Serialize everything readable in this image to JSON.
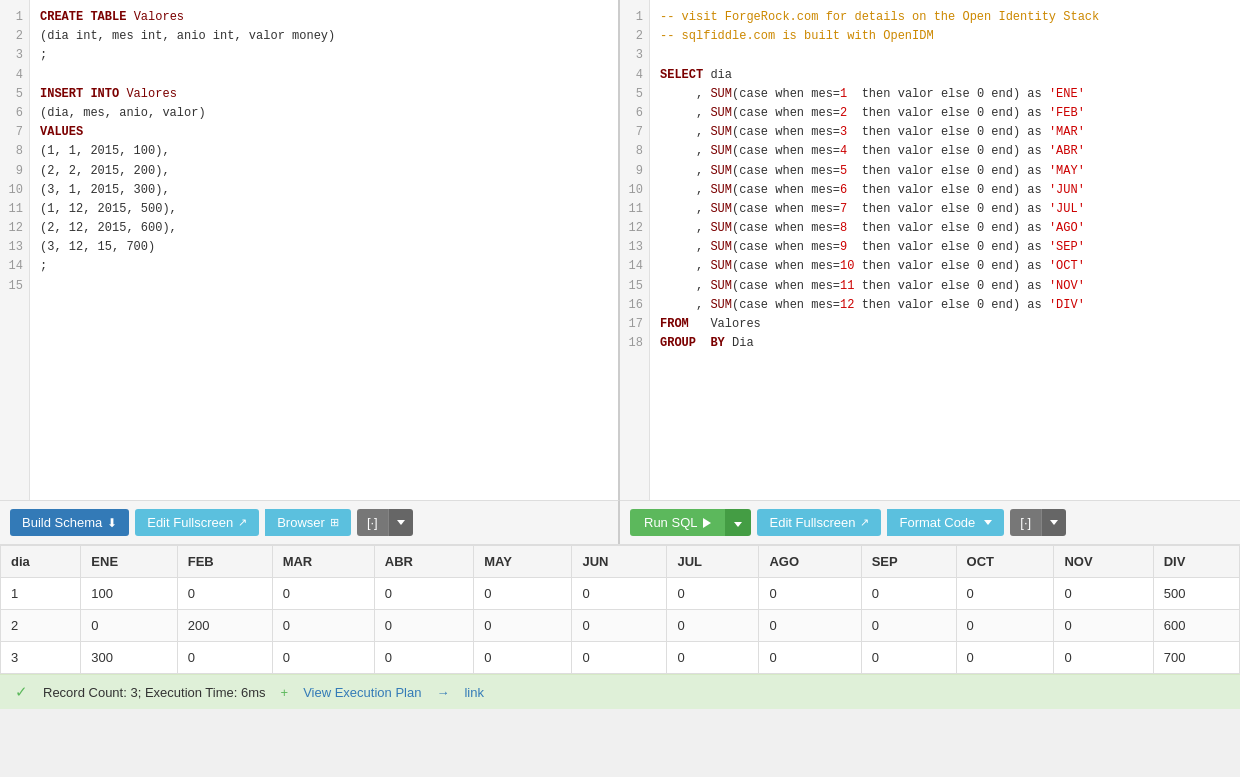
{
  "left_editor": {
    "lines": [
      1,
      2,
      3,
      4,
      5,
      6,
      7,
      8,
      9,
      10,
      11,
      12,
      13,
      14,
      15
    ],
    "code_html": "left"
  },
  "right_editor": {
    "lines": [
      1,
      2,
      3,
      4,
      5,
      6,
      7,
      8,
      9,
      10,
      11,
      12,
      13,
      14,
      15,
      16,
      17,
      18
    ],
    "code_html": "right"
  },
  "left_toolbar": {
    "build_schema": "Build Schema",
    "edit_fullscreen": "Edit Fullscreen",
    "browser": "Browser",
    "bracket": "[·]"
  },
  "right_toolbar": {
    "run_sql": "Run SQL",
    "edit_fullscreen": "Edit Fullscreen",
    "format_code": "Format Code",
    "bracket": "[·]"
  },
  "table": {
    "headers": [
      "dia",
      "ENE",
      "FEB",
      "MAR",
      "ABR",
      "MAY",
      "JUN",
      "JUL",
      "AGO",
      "SEP",
      "OCT",
      "NOV",
      "DIV"
    ],
    "rows": [
      [
        1,
        100,
        0,
        0,
        0,
        0,
        0,
        0,
        0,
        0,
        0,
        0,
        500
      ],
      [
        2,
        0,
        200,
        0,
        0,
        0,
        0,
        0,
        0,
        0,
        0,
        0,
        600
      ],
      [
        3,
        300,
        0,
        0,
        0,
        0,
        0,
        0,
        0,
        0,
        0,
        0,
        700
      ]
    ]
  },
  "status": {
    "record_count": "Record Count: 3; Execution Time: 6ms",
    "view_plan": "View Execution Plan",
    "link": "link"
  }
}
